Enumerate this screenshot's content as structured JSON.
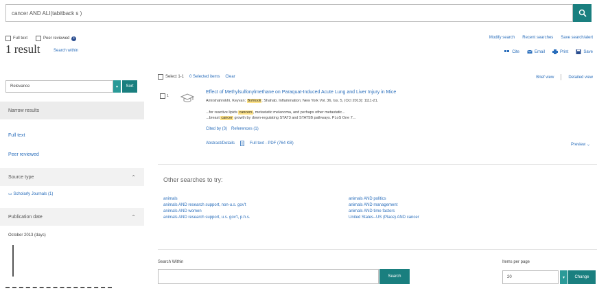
{
  "search": {
    "query": "cancer AND ALI(tabitback s )"
  },
  "filters": {
    "full_text": "Full text",
    "peer_reviewed": "Peer reviewed"
  },
  "results": {
    "count_text": "1 result",
    "search_within_link": "Search within"
  },
  "top_links": [
    "Modify search",
    "Recent searches",
    "Save search/alert"
  ],
  "actions": {
    "cite": "Cite",
    "email": "Email",
    "print": "Print",
    "save": "Save"
  },
  "sort": {
    "value": "Relevance",
    "button": "Sort"
  },
  "sidebar": {
    "narrow_results": "Narrow results",
    "full_text": "Full text",
    "peer_reviewed": "Peer reviewed",
    "source_type": "Source type",
    "source_item": "Scholarly Journals (1)",
    "publication_date": "Publication date",
    "date_range": "October 2013 (days)"
  },
  "list_header": {
    "select": "Select 1-1",
    "selected": "0 Selected items",
    "clear": "Clear",
    "brief_view": "Brief view",
    "detailed_view": "Detailed view"
  },
  "result": {
    "number": "1",
    "title": "Effect of Methylsulfonylmethane on Paraquat-Induced Acute Lung and Liver Injury in Mice",
    "authors_prefix": "Amirshahrokhi, Keyvan;",
    "authors_highlight": "Bohlooli",
    "authors_suffix": "; Shahab. Inflammation; New York Vol. 36, Iss. 5, (Oct 2013): 1111-21.",
    "snippet1_prefix": "...for reactive lipids",
    "snippet1_highlight": "cancers",
    "snippet1_suffix": ", metastatic melanoma, and perhaps other metastatic...",
    "snippet2_prefix": "...breast",
    "snippet2_highlight": "cancer",
    "snippet2_suffix": "growth by down-regulating STAT3 and STAT5B pathways. PLoS One 7...",
    "cited_by": "Cited by (3)",
    "references": "References (1)",
    "abstract": "Abstract/Details",
    "full_text_pdf": "Full text - PDF (764 KB)",
    "preview": "Preview"
  },
  "other_searches": {
    "title": "Other searches to try:",
    "left": [
      "animals",
      "animals AND research support, non-u.s. gov't",
      "animals AND women",
      "animals AND research support, u.s. gov't, p.h.s."
    ],
    "right": [
      "animals AND politics",
      "animals AND management",
      "animals AND time factors",
      "United States--US (Place) AND cancer"
    ]
  },
  "search_within": {
    "label": "Search Within",
    "button": "Search"
  },
  "items_per_page": {
    "label": "Items per page",
    "value": "20",
    "button": "Change"
  }
}
